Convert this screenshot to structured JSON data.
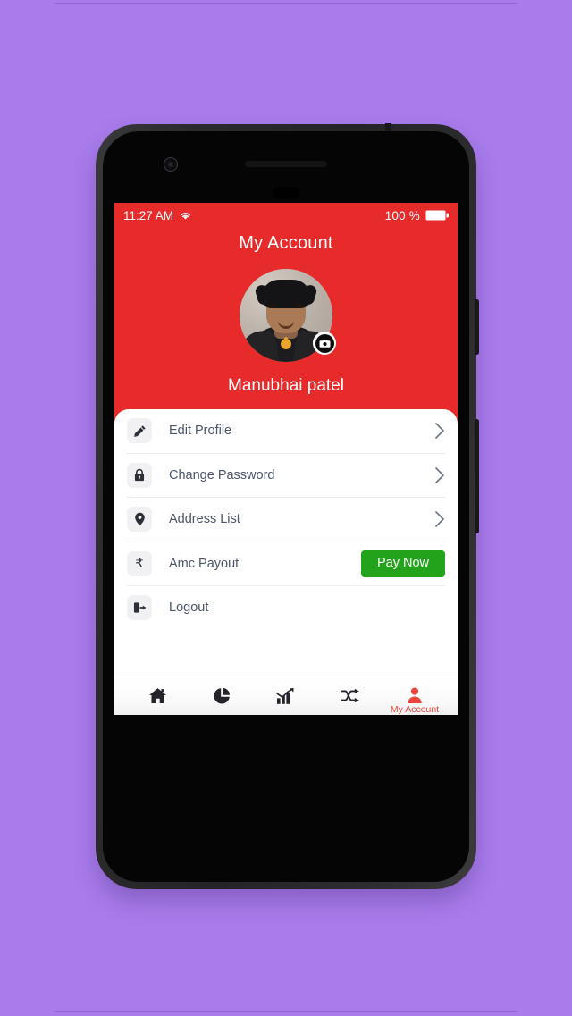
{
  "theme": {
    "backdrop": "#a97cec",
    "header_red": "#e72a2a",
    "accent_green": "#22a31b",
    "active_nav": "#e8453c",
    "label_slate": "#4a5568"
  },
  "status_bar": {
    "time": "11:27 AM",
    "wifi_icon": "wifi-icon",
    "battery_percent": "100 %",
    "battery_icon": "battery-full-icon"
  },
  "header": {
    "title": "My Account",
    "profile_name": "Manubhai patel",
    "avatar_label": "profile-photo",
    "camera_badge_icon": "camera-icon"
  },
  "menu": {
    "items": [
      {
        "label": "Edit Profile",
        "icon": "pencil-icon",
        "action": "chevron"
      },
      {
        "label": "Change Password",
        "icon": "lock-icon",
        "action": "chevron"
      },
      {
        "label": "Address List",
        "icon": "location-pin-icon",
        "action": "chevron"
      },
      {
        "label": "Amc Payout",
        "icon": "rupee-icon",
        "action": "button",
        "button_label": "Pay Now"
      },
      {
        "label": "Logout",
        "icon": "logout-icon",
        "action": "none"
      }
    ]
  },
  "bottom_nav": {
    "items": [
      {
        "icon": "home-icon",
        "label": "",
        "active": false
      },
      {
        "icon": "pie-chart-icon",
        "label": "",
        "active": false
      },
      {
        "icon": "bar-chart-trending-icon",
        "label": "",
        "active": false
      },
      {
        "icon": "shuffle-icon",
        "label": "",
        "active": false
      },
      {
        "icon": "person-icon",
        "label": "My Account",
        "active": true
      }
    ]
  }
}
